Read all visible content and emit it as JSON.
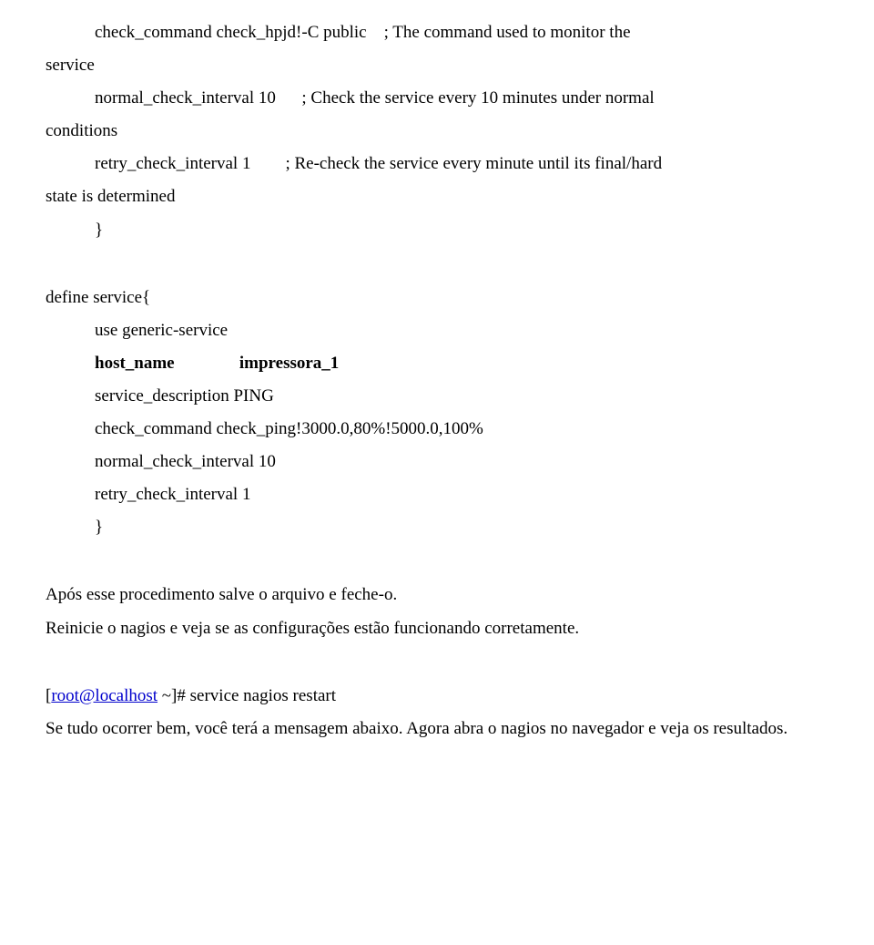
{
  "l1_a": "check_command          check_hpjd!-C public",
  "l1_b": "; The command used to monitor the",
  "l2": "service",
  "l3_a": "normal_check_interval   10",
  "l3_b": "; Check the service every 10 minutes under normal",
  "l4": "conditions",
  "l5_a": "retry_check_interval    1",
  "l5_b": "; Re-check the service every minute until its final/hard",
  "l6": "state is determined",
  "l7": "}",
  "l8": "define service{",
  "l9": "use                      generic-service",
  "l10_a": "host_name",
  "l10_b": "impressora_1",
  "l11": "service_description    PING",
  "l12": "check_command            check_ping!3000.0,80%!5000.0,100%",
  "l13": "normal_check_interval   10",
  "l14": "retry_check_interval    1",
  "l15": "}",
  "p1": "Após esse procedimento salve o arquivo e feche-o.",
  "p2": "Reinicie o nagios e veja se as configurações estão funcionando corretamente.",
  "p3_prefix": "[",
  "p3_link": "root@localhost",
  "p3_suffix": " ~]# service nagios restart",
  "p4": "Se tudo ocorrer bem, você terá a mensagem abaixo. Agora abra o nagios no navegador e veja os resultados."
}
